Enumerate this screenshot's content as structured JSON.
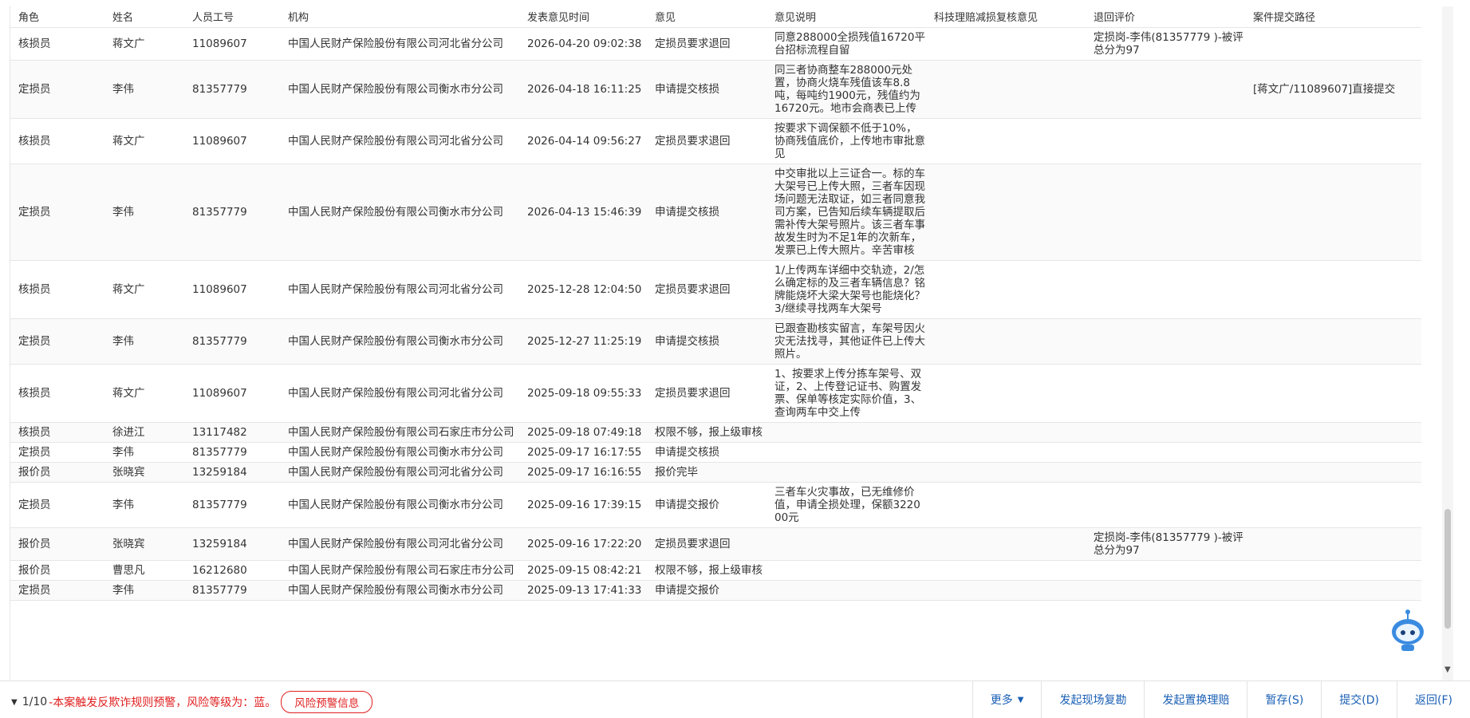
{
  "table": {
    "headers": [
      "角色",
      "姓名",
      "人员工号",
      "机构",
      "发表意见时间",
      "意见",
      "意见说明",
      "科技理赔减损复核意见",
      "退回评价",
      "案件提交路径"
    ],
    "rows": [
      {
        "role": "核损员",
        "name": "蒋文广",
        "id": "11089607",
        "org": "中国人民财产保险股份有限公司河北省分公司",
        "time": "2026-04-20 09:02:38",
        "opinion": "定损员要求退回",
        "desc": "同意288000全损残值16720平台招标流程自留",
        "review": "",
        "rating": "定损岗-李伟(81357779 )-被评总分为97",
        "path": ""
      },
      {
        "role": "定损员",
        "name": "李伟",
        "id": "81357779",
        "org": "中国人民财产保险股份有限公司衡水市分公司",
        "time": "2026-04-18 16:11:25",
        "opinion": "申请提交核损",
        "desc": "同三者协商整车288000元处置，协商火烧车残值该车8.8吨，每吨约1900元，残值约为16720元。地市会商表已上传",
        "review": "",
        "rating": "",
        "path": "[蒋文广/11089607]直接提交"
      },
      {
        "role": "核损员",
        "name": "蒋文广",
        "id": "11089607",
        "org": "中国人民财产保险股份有限公司河北省分公司",
        "time": "2026-04-14 09:56:27",
        "opinion": "定损员要求退回",
        "desc": "按要求下调保额不低于10%，协商残值底价，上传地市审批意见",
        "review": "",
        "rating": "",
        "path": ""
      },
      {
        "role": "定损员",
        "name": "李伟",
        "id": "81357779",
        "org": "中国人民财产保险股份有限公司衡水市分公司",
        "time": "2026-04-13 15:46:39",
        "opinion": "申请提交核损",
        "desc": "中交审批以上三证合一。标的车大架号已上传大照，三者车因现场问题无法取证，如三者同意我司方案，已告知后续车辆提取后需补传大架号照片。该三者车事故发生时为不足1年的次新车，发票已上传大照片。辛苦审核",
        "review": "",
        "rating": "",
        "path": ""
      },
      {
        "role": "核损员",
        "name": "蒋文广",
        "id": "11089607",
        "org": "中国人民财产保险股份有限公司河北省分公司",
        "time": "2025-12-28 12:04:50",
        "opinion": "定损员要求退回",
        "desc": "1/上传两车详细中交轨迹，2/怎么确定标的及三者车辆信息？铭牌能烧坏大梁大架号也能烧化？3/继续寻找两车大架号",
        "review": "",
        "rating": "",
        "path": ""
      },
      {
        "role": "定损员",
        "name": "李伟",
        "id": "81357779",
        "org": "中国人民财产保险股份有限公司衡水市分公司",
        "time": "2025-12-27 11:25:19",
        "opinion": "申请提交核损",
        "desc": "已跟查勘核实留言，车架号因火灾无法找寻，其他证件已上传大照片。",
        "review": "",
        "rating": "",
        "path": ""
      },
      {
        "role": "核损员",
        "name": "蒋文广",
        "id": "11089607",
        "org": "中国人民财产保险股份有限公司河北省分公司",
        "time": "2025-09-18 09:55:33",
        "opinion": "定损员要求退回",
        "desc": "1、按要求上传分拣车架号、双证，2、上传登记证书、购置发票、保单等核定实际价值，3、查询两车中交上传",
        "review": "",
        "rating": "",
        "path": ""
      },
      {
        "role": "核损员",
        "name": "徐进江",
        "id": "13117482",
        "org": "中国人民财产保险股份有限公司石家庄市分公司",
        "time": "2025-09-18 07:49:18",
        "opinion": "权限不够，报上级审核",
        "desc": "",
        "review": "",
        "rating": "",
        "path": ""
      },
      {
        "role": "定损员",
        "name": "李伟",
        "id": "81357779",
        "org": "中国人民财产保险股份有限公司衡水市分公司",
        "time": "2025-09-17 16:17:55",
        "opinion": "申请提交核损",
        "desc": "",
        "review": "",
        "rating": "",
        "path": ""
      },
      {
        "role": "报价员",
        "name": "张晓宾",
        "id": "13259184",
        "org": "中国人民财产保险股份有限公司河北省分公司",
        "time": "2025-09-17 16:16:55",
        "opinion": "报价完毕",
        "desc": "",
        "review": "",
        "rating": "",
        "path": ""
      },
      {
        "role": "定损员",
        "name": "李伟",
        "id": "81357779",
        "org": "中国人民财产保险股份有限公司衡水市分公司",
        "time": "2025-09-16 17:39:15",
        "opinion": "申请提交报价",
        "desc": "三者车火灾事故，已无维修价值，申请全损处理，保额322000元",
        "review": "",
        "rating": "",
        "path": ""
      },
      {
        "role": "报价员",
        "name": "张晓宾",
        "id": "13259184",
        "org": "中国人民财产保险股份有限公司河北省分公司",
        "time": "2025-09-16 17:22:20",
        "opinion": "定损员要求退回",
        "desc": "",
        "review": "",
        "rating": "定损岗-李伟(81357779 )-被评总分为97",
        "path": ""
      },
      {
        "role": "报价员",
        "name": "曹思凡",
        "id": "16212680",
        "org": "中国人民财产保险股份有限公司石家庄市分公司",
        "time": "2025-09-15 08:42:21",
        "opinion": "权限不够，报上级审核",
        "desc": "",
        "review": "",
        "rating": "",
        "path": ""
      },
      {
        "role": "定损员",
        "name": "李伟",
        "id": "81357779",
        "org": "中国人民财产保险股份有限公司衡水市分公司",
        "time": "2025-09-13 17:41:33",
        "opinion": "申请提交报价",
        "desc": "",
        "review": "",
        "rating": "",
        "path": ""
      }
    ]
  },
  "footer": {
    "page": "1/10",
    "warning": "-本案触发反欺诈规则预警，风险等级为：蓝。",
    "risk_button": "风险预警信息",
    "buttons": [
      "更多",
      "发起现场复勘",
      "发起置换理赔",
      "暂存(S)",
      "提交(D)",
      "返回(F)"
    ]
  },
  "icons": {
    "caret": "caret-down-icon",
    "robot": "robot-assistant-icon"
  },
  "colors": {
    "link": "#1a5fb4",
    "warning": "#e02020"
  }
}
